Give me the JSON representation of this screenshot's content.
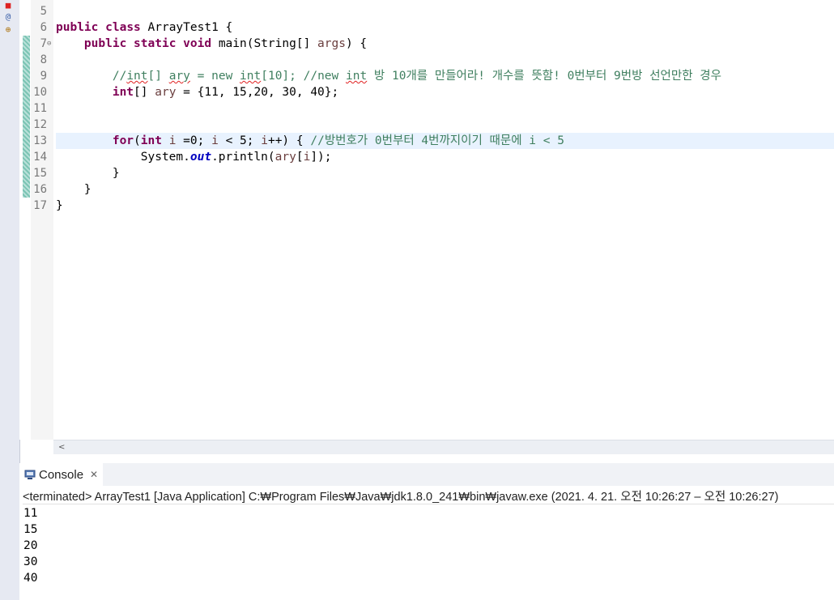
{
  "editor": {
    "line_numbers": [
      "5",
      "6",
      "7",
      "8",
      "9",
      "10",
      "11",
      "12",
      "13",
      "14",
      "15",
      "16",
      "17"
    ],
    "lines": {
      "l6": {
        "kw1": "public",
        "kw2": "class",
        "text": " ArrayTest1 {"
      },
      "l7": {
        "kw1": "public",
        "kw2": "static",
        "kw3": "void",
        "text1": " main(String[] ",
        "var": "args",
        "text2": ") {"
      },
      "l9": {
        "c1": "//",
        "c2": "int",
        "c3": "[] ",
        "c4": "ary",
        "c5": " = new ",
        "c6": "int",
        "c7": "[10]; //new ",
        "c8": "int",
        "c9": " 방 10개를 만들어라! 개수를 뜻함! 0번부터 9번방 선언만한 경우"
      },
      "l10": {
        "kw": "int",
        "text1": "[] ",
        "var": "ary",
        "text2": " = {11, 15,20, 30, 40};"
      },
      "l13": {
        "kw1": "for",
        "text1": "(",
        "kw2": "int",
        "text2": " ",
        "v1": "i",
        "text3": " =0; ",
        "v2": "i",
        "text4": " < 5; ",
        "v3": "i",
        "text5": "++) { ",
        "comment": "//방번호가 0번부터 4번까지이기 때문에 i < 5"
      },
      "l14": {
        "text1": "System.",
        "static": "out",
        "text2": ".println(",
        "var1": "ary",
        "text3": "[",
        "var2": "i",
        "text4": "]);"
      },
      "l15": {
        "text": "}"
      },
      "l16": {
        "text": "}"
      },
      "l17": {
        "text": "}"
      }
    }
  },
  "console": {
    "tab_label": "Console",
    "close_glyph": "✕",
    "status": "<terminated> ArrayTest1 [Java Application] C:₩Program Files₩Java₩jdk1.8.0_241₩bin₩javaw.exe  (2021. 4. 21. 오전 10:26:27 – 오전 10:26:27)",
    "output": [
      "11",
      "15",
      "20",
      "30",
      "40"
    ]
  },
  "scrollbar": {
    "left_arrow": "<"
  },
  "icons": {
    "console": "console-icon",
    "close": "close-icon",
    "fold": "collapse-icon"
  }
}
